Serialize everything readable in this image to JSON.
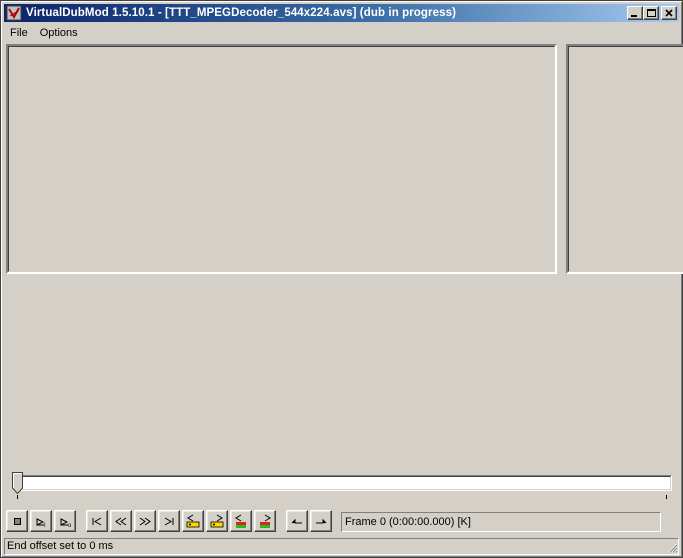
{
  "window": {
    "title": "VirtualDubMod 1.5.10.1 - [TTT_MPEGDecoder_544x224.avs] (dub in progress)",
    "app_icon": "virtualdub-icon",
    "controls": [
      "minimize-icon",
      "maximize-icon",
      "close-icon"
    ]
  },
  "menu": {
    "items": [
      {
        "label": "File"
      },
      {
        "label": "Options"
      }
    ]
  },
  "panes": {
    "input": "input-video-pane",
    "output": "output-video-pane"
  },
  "timeline": {
    "position": 0,
    "thumb_icon": "slider-thumb"
  },
  "toolbar": {
    "buttons": [
      {
        "name": "stop-button",
        "icon": "stop-icon"
      },
      {
        "name": "play-input-button",
        "icon": "play-input-icon"
      },
      {
        "name": "play-output-button",
        "icon": "play-output-icon"
      },
      {
        "name": "start-button",
        "icon": "go-start-icon"
      },
      {
        "name": "prev-frame-button",
        "icon": "step-back-icon"
      },
      {
        "name": "next-frame-button",
        "icon": "step-forward-icon"
      },
      {
        "name": "end-button",
        "icon": "go-end-icon"
      },
      {
        "name": "prev-keyframe-button",
        "icon": "key-back-icon"
      },
      {
        "name": "next-keyframe-button",
        "icon": "key-forward-icon"
      },
      {
        "name": "prev-scene-button",
        "icon": "scene-back-icon"
      },
      {
        "name": "next-scene-button",
        "icon": "scene-forward-icon"
      },
      {
        "name": "mark-in-button",
        "icon": "mark-in-icon"
      },
      {
        "name": "mark-out-button",
        "icon": "mark-out-icon"
      }
    ],
    "frame_text": "Frame 0 (0:00:00.000) [K]"
  },
  "status": {
    "text": "End offset set to 0 ms"
  }
}
